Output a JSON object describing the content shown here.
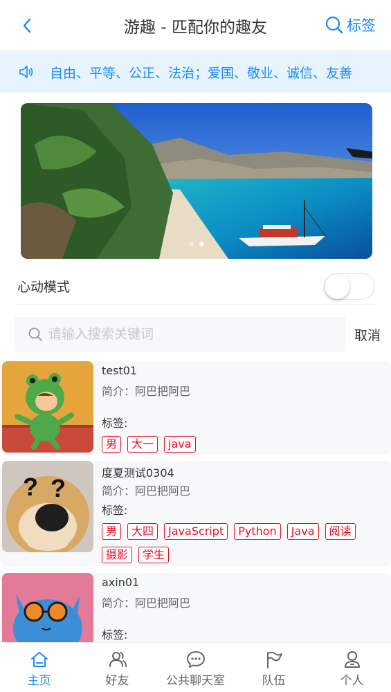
{
  "navbar": {
    "title": "游趣 - 匹配你的趣友",
    "right_label": "标签",
    "back_icon": "chevron-left-icon",
    "search_icon": "search-icon"
  },
  "notice": {
    "text": "自由、平等、公正、法治；爱国、敬业、诚信、友善",
    "icon": "speaker-icon"
  },
  "swipe": {
    "slide_count": 2,
    "active_index": 1
  },
  "heart_mode": {
    "label": "心动模式",
    "enabled": false
  },
  "search": {
    "placeholder": "请输入搜索关键词",
    "value": "",
    "cancel_label": "取消"
  },
  "users": [
    {
      "name": "test01",
      "desc": "简介：阿巴把阿巴",
      "tags_label": "标签:",
      "tags": [
        "男",
        "大一",
        "java"
      ]
    },
    {
      "name": "度夏测试0304",
      "desc": "简介：阿巴把阿巴",
      "tags_label": "标签:",
      "tags": [
        "男",
        "大四",
        "JavaScript",
        "Python",
        "Java",
        "阅读",
        "摄影",
        "学生"
      ]
    },
    {
      "name": "axin01",
      "desc": "简介：阿巴把阿巴",
      "tags_label": "标签:",
      "tags": []
    }
  ],
  "tabbar": {
    "items": [
      {
        "label": "主页",
        "icon": "home-icon",
        "active": true
      },
      {
        "label": "好友",
        "icon": "friends-icon",
        "active": false
      },
      {
        "label": "公共聊天室",
        "icon": "chat-icon",
        "active": false
      },
      {
        "label": "队伍",
        "icon": "flag-icon",
        "active": false
      },
      {
        "label": "个人",
        "icon": "user-icon",
        "active": false
      }
    ]
  },
  "colors": {
    "accent": "#1989fa",
    "tag": "#ee0a24",
    "notice_bg": "#e8f4fd",
    "card_bg": "#f7f8fa"
  }
}
